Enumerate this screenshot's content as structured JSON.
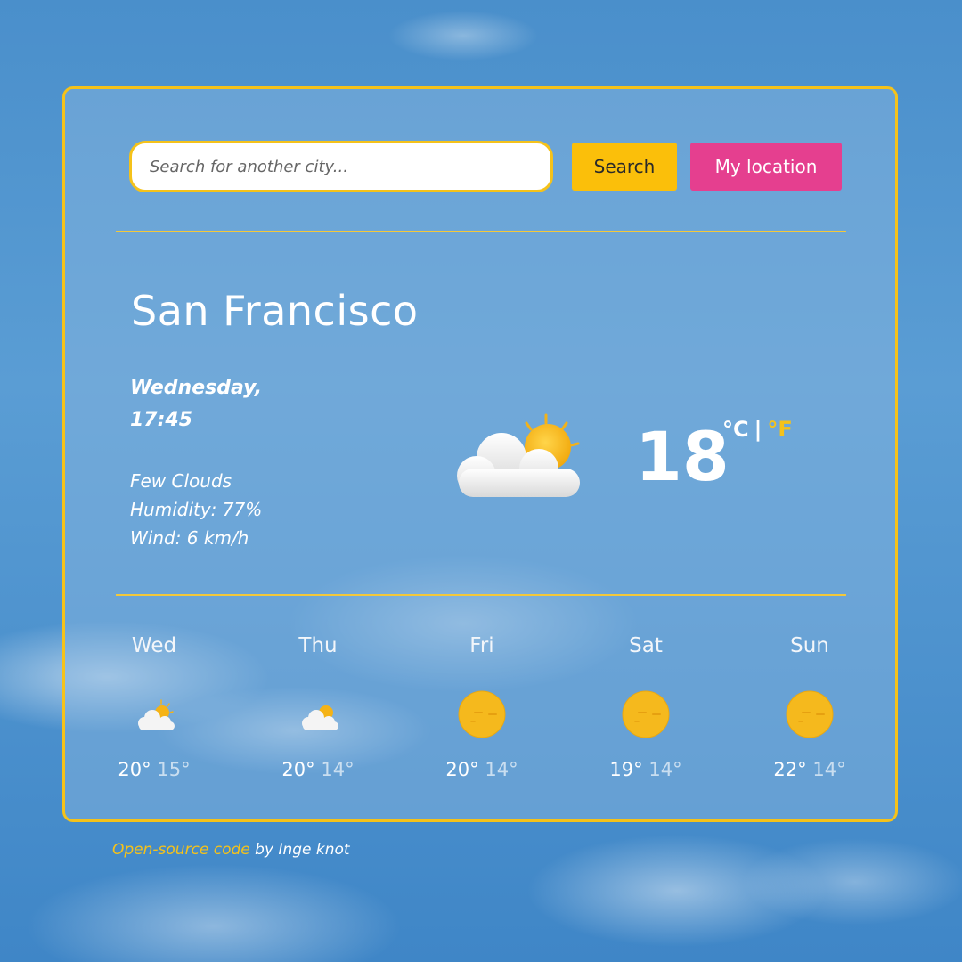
{
  "search": {
    "placeholder": "Search for another city...",
    "search_label": "Search",
    "location_label": "My location"
  },
  "current": {
    "city": "San Francisco",
    "day": "Wednesday,",
    "time": "17:45",
    "description": "Few Clouds",
    "humidity": "Humidity: 77%",
    "wind": "Wind: 6 km/h",
    "temperature": "18",
    "unit_c": "°C",
    "unit_sep": "|",
    "unit_f": "°F",
    "icon": "few-clouds-icon"
  },
  "forecast": [
    {
      "day": "Wed",
      "high": "20°",
      "low": "15°",
      "icon": "few-clouds-icon"
    },
    {
      "day": "Thu",
      "high": "20°",
      "low": "14°",
      "icon": "few-clouds-icon"
    },
    {
      "day": "Fri",
      "high": "20°",
      "low": "14°",
      "icon": "sun-icon"
    },
    {
      "day": "Sat",
      "high": "19°",
      "low": "14°",
      "icon": "sun-icon"
    },
    {
      "day": "Sun",
      "high": "22°",
      "low": "14°",
      "icon": "sun-icon"
    }
  ],
  "footer": {
    "link_text": "Open-source code",
    "suffix": " by Inge knot"
  },
  "colors": {
    "accent_yellow": "#f5c21a",
    "search_button": "#fbbf0a",
    "location_button": "#e53f8f"
  }
}
